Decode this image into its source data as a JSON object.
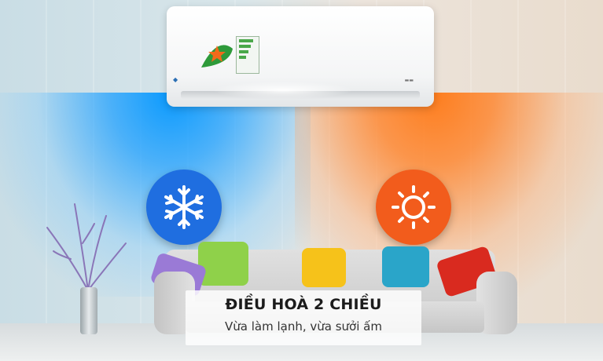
{
  "caption": {
    "title": "ĐIỀU HOÀ 2 CHIỀU",
    "subtitle": "Vừa làm lạnh, vừa sưởi ấm"
  },
  "icons": {
    "cooling": "snowflake-icon",
    "heating": "sun-icon"
  },
  "colors": {
    "cooling_badge": "#1f6ee0",
    "heating_badge": "#f25c1c",
    "cool_air": "#1e9bff",
    "warm_air": "#ff7a1a"
  }
}
